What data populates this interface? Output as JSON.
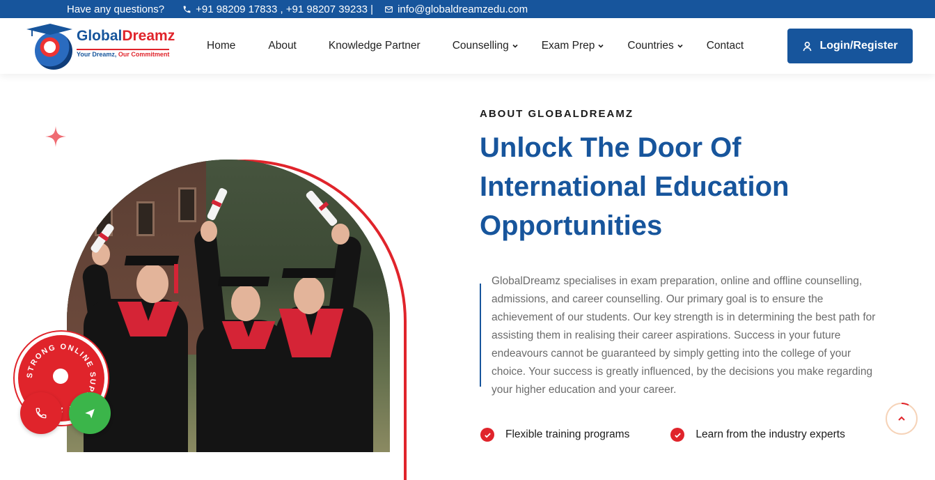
{
  "topbar": {
    "question": "Have any questions?",
    "phones": "+91 98209 17833 , +91 98207 39233 |",
    "email": "info@globaldreamzedu.com",
    "icons": {
      "phone": "phone-icon",
      "email": "mail-icon"
    }
  },
  "header": {
    "logo": {
      "brand_part1": "Global",
      "brand_part2": "Dreamz",
      "tagline_part1": "Your Dreamz, ",
      "tagline_part2": "Our Commitment"
    },
    "nav": [
      {
        "label": "Home",
        "has_dropdown": false
      },
      {
        "label": "About",
        "has_dropdown": false
      },
      {
        "label": "Knowledge Partner",
        "has_dropdown": false
      },
      {
        "label": "Counselling",
        "has_dropdown": true
      },
      {
        "label": "Exam Prep",
        "has_dropdown": true
      },
      {
        "label": "Countries",
        "has_dropdown": true
      },
      {
        "label": "Contact",
        "has_dropdown": false
      }
    ],
    "login_label": "Login/Register"
  },
  "hero": {
    "eyebrow": "ABOUT GLOBALDREAMZ",
    "headline_lines": [
      "Unlock The Door Of",
      "International Education",
      "Opportunities"
    ],
    "paragraph": "GlobalDreamz specialises in exam preparation, online and offline counselling, admissions, and career counselling. Our primary goal is to ensure the achievement of our students. Our key strength is in determining the best path for assisting them in realising their career aspirations. Success in your future endeavours cannot be guaranteed by simply getting into the college of your choice. Your success is greatly influenced, by the decisions you make regarding your higher education and your career.",
    "features": [
      "Flexible training programs",
      "Learn from the industry experts"
    ]
  },
  "support_badge": {
    "text": "STRONG ONLINE SUPPORT 24/7"
  },
  "colors": {
    "brand_blue": "#17559c",
    "brand_red": "#e0242b",
    "whatsapp_green": "#3bb54a"
  }
}
